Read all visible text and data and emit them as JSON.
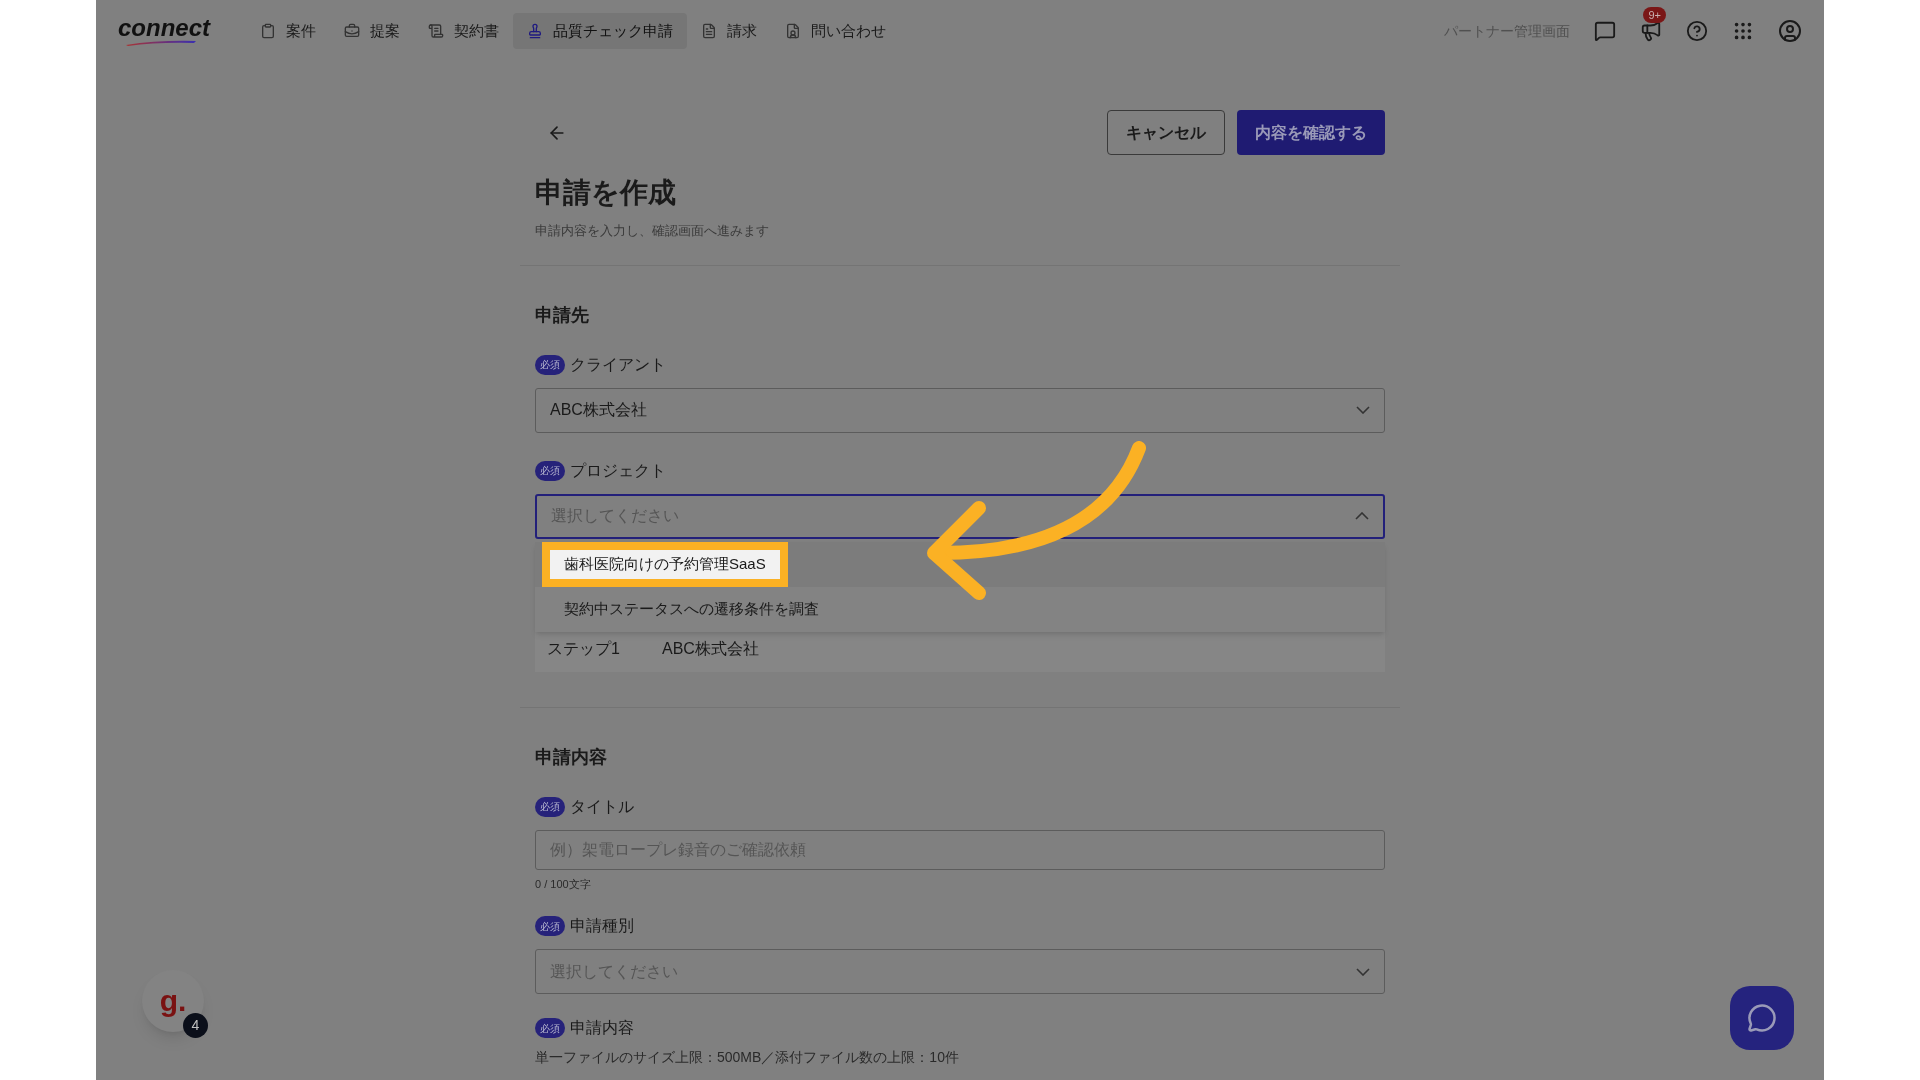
{
  "nav": {
    "logo": "connect",
    "items": [
      {
        "label": "案件",
        "selected": false
      },
      {
        "label": "提案",
        "selected": false
      },
      {
        "label": "契約書",
        "selected": false
      },
      {
        "label": "品質チェック申請",
        "selected": true
      },
      {
        "label": "請求",
        "selected": false
      },
      {
        "label": "問い合わせ",
        "selected": false
      }
    ],
    "partner_label": "パートナー管理画面",
    "notification_badge": "9+"
  },
  "header": {
    "cancel": "キャンセル",
    "confirm": "内容を確認する",
    "title": "申請を作成",
    "subtitle": "申請内容を入力し、確認画面へ進みます"
  },
  "destination": {
    "heading": "申請先",
    "client": {
      "required": "必須",
      "label": "クライアント",
      "value": "ABC株式会社"
    },
    "project": {
      "required": "必須",
      "label": "プロジェクト",
      "placeholder": "選択してください",
      "expanded": true,
      "options": [
        {
          "label": "歯科医院向けの予約管理SaaS",
          "highlighted": true
        },
        {
          "label": "契約中ステータスへの遷移条件を調査",
          "highlighted": false
        }
      ]
    },
    "step": {
      "label": "ステップ1",
      "value": "ABC株式会社"
    }
  },
  "content": {
    "heading": "申請内容",
    "title": {
      "required": "必須",
      "label": "タイトル",
      "placeholder": "例）架電ロープレ録音のご確認依頼",
      "counter": "0 / 100文字"
    },
    "type": {
      "required": "必須",
      "label": "申請種別",
      "placeholder": "選択してください"
    },
    "body": {
      "required": "必須",
      "label": "申請内容",
      "note": "単一ファイルのサイズ上限：500MB／添付ファイル数の上限：10件"
    }
  },
  "widget": {
    "letter": "g.",
    "badge": "4"
  }
}
